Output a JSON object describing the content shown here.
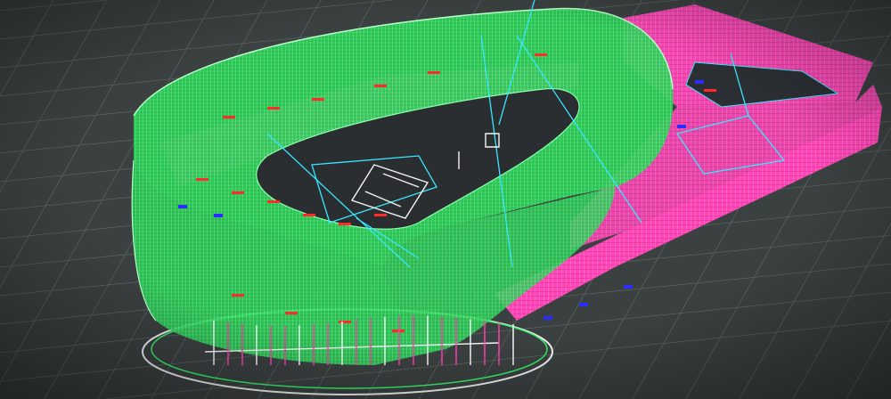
{
  "viewport": {
    "background": "#3b4040",
    "grid_color": "#5a6262"
  },
  "model": {
    "shell_color": "#36f06a",
    "shell_edge_color": "#8cffae",
    "facade_color": "#ff3fb0",
    "accent_cyan": "#39e6ff",
    "accent_blue": "#2c2cff",
    "accent_red": "#ff2a2a",
    "accent_white": "#f4f4f4"
  }
}
